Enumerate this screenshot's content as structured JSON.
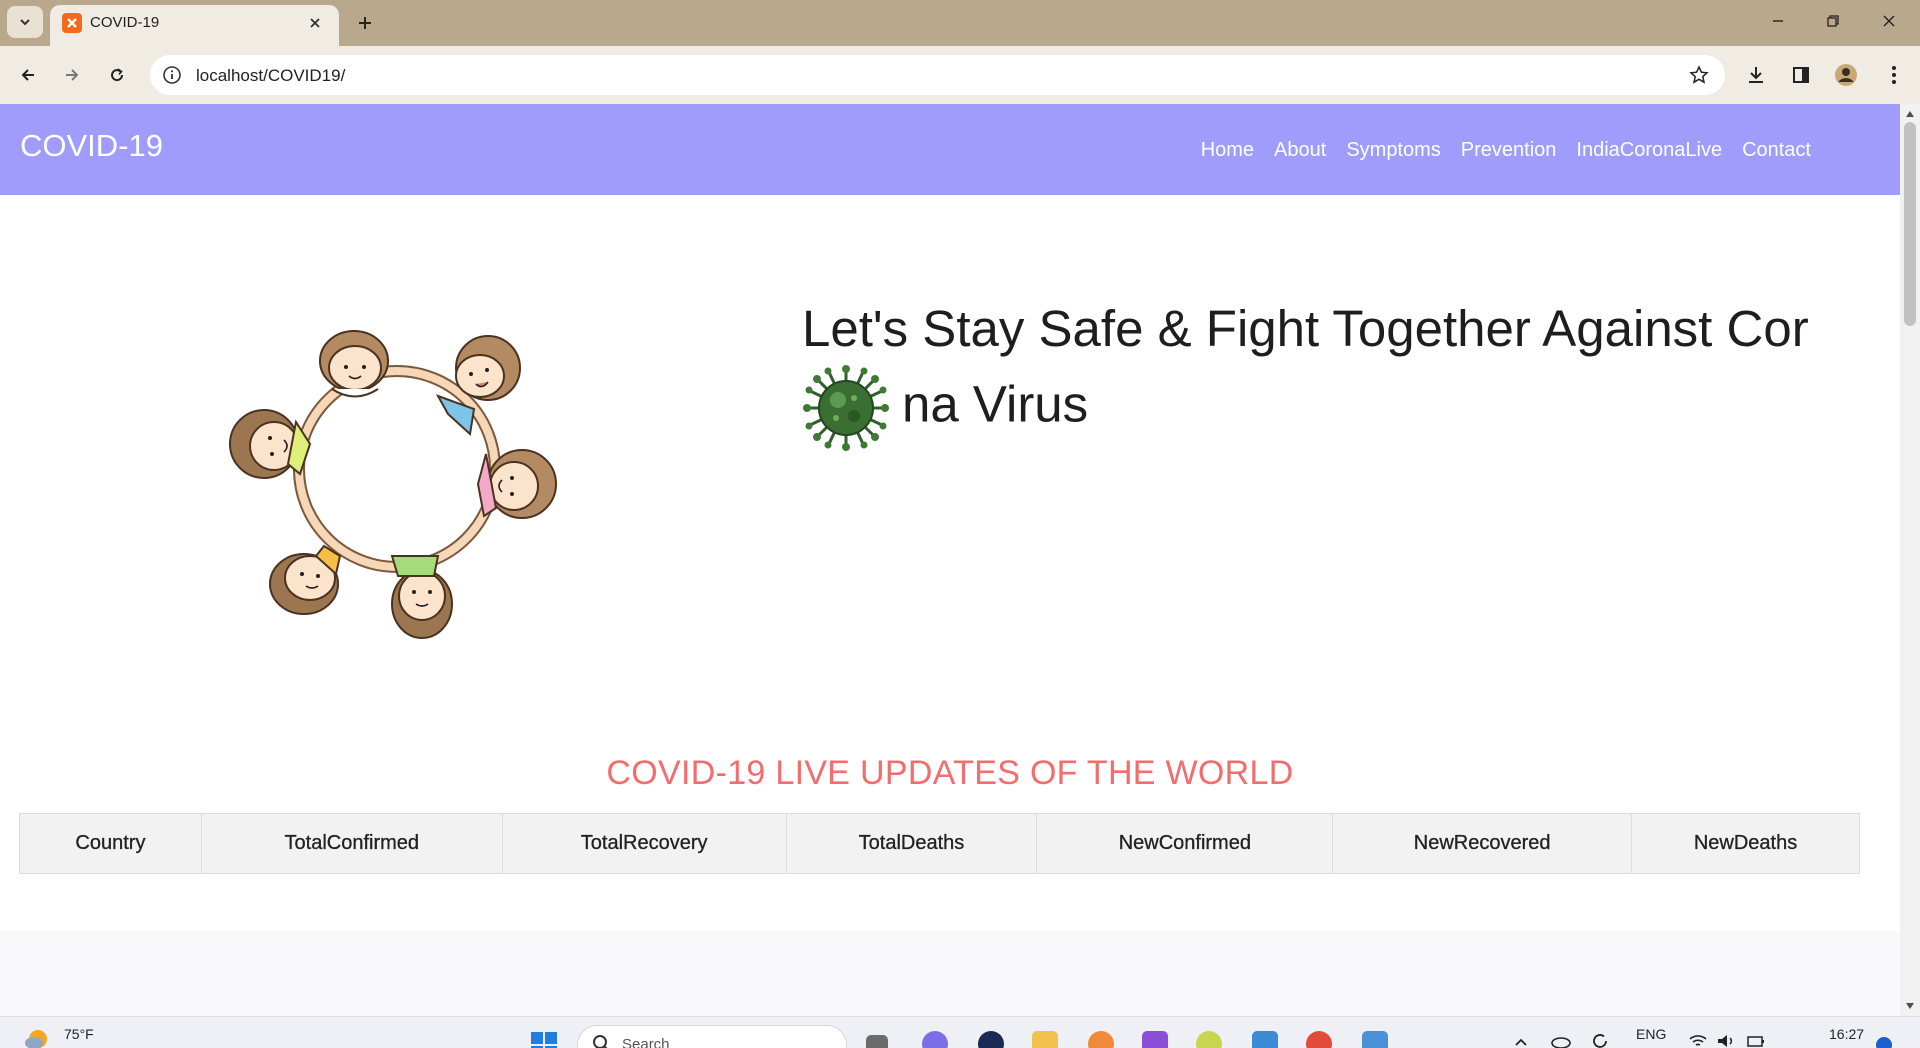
{
  "browser": {
    "tab_title": "COVID-19",
    "url": "localhost/COVID19/"
  },
  "site": {
    "brand": "COVID-19",
    "nav": [
      "Home",
      "About",
      "Symptoms",
      "Prevention",
      "IndiaCoronaLive",
      "Contact"
    ]
  },
  "hero": {
    "line1": "Let's Stay Safe & Fight Together Against Cor",
    "line2": "na Virus"
  },
  "live": {
    "title": "COVID-19 LIVE UPDATES OF THE WORLD",
    "columns": [
      "Country",
      "TotalConfirmed",
      "TotalRecovery",
      "TotalDeaths",
      "NewConfirmed",
      "NewRecovered",
      "NewDeaths"
    ]
  },
  "taskbar": {
    "weather": "75°F",
    "search_placeholder": "Search",
    "language": "ENG",
    "time": "16:27"
  },
  "colors": {
    "nav_bg": "#a09cfb",
    "section_title": "#f26d6d",
    "tabstrip": "#b9a88b",
    "toolbar": "#f1ece3"
  }
}
